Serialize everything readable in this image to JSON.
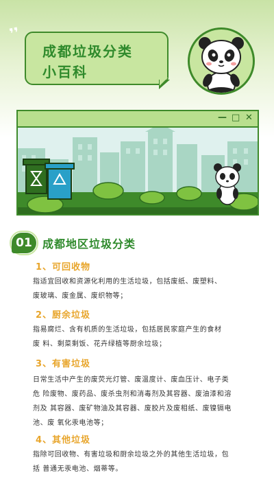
{
  "header": {
    "title_line1": "成都垃圾分类",
    "title_line2": "小百科"
  },
  "window": {
    "minimize_glyph": "—",
    "maximize_glyph": "□",
    "close_glyph": "✕"
  },
  "section": {
    "number": "01",
    "title": "成都地区垃圾分类"
  },
  "categories": [
    {
      "title": "1、可回收物",
      "desc_lines": [
        "指适宜回收和资源化利用的生活垃圾，包括废纸、废塑料、",
        "废玻璃、废金属、废织物等；"
      ]
    },
    {
      "title": "2、厨余垃圾",
      "desc_lines": [
        "指易腐烂、含有机质的生活垃圾，包括居民家庭产生的食材",
        "废 料、剩菜剩饭、花卉绿植等厨余垃圾；"
      ]
    },
    {
      "title": "3、有害垃圾",
      "desc_lines": [
        "日常生活中产生的废荧光灯管、废温度计、废血压计、电子类",
        "危 险废物、废药品、废杀虫剂和消毒剂及其容器、废油漆和溶",
        "剂及 其容器、废矿物油及其容器、废胶片及废相纸、废镍镉电",
        "池、废 氧化汞电池等；"
      ]
    },
    {
      "title": "4、其他垃圾",
      "desc_lines": [
        "指除可回收物、有害垃圾和厨余垃圾之外的其他生活垃圾，包",
        "括 普通无汞电池、烟蒂等。"
      ]
    }
  ],
  "colors": {
    "primary_green": "#3e8a2a",
    "light_green": "#c8e6a0",
    "accent_orange": "#e8a52b"
  },
  "icons": [
    "panda-illustration",
    "recycle-icon",
    "hourglass-icon"
  ]
}
